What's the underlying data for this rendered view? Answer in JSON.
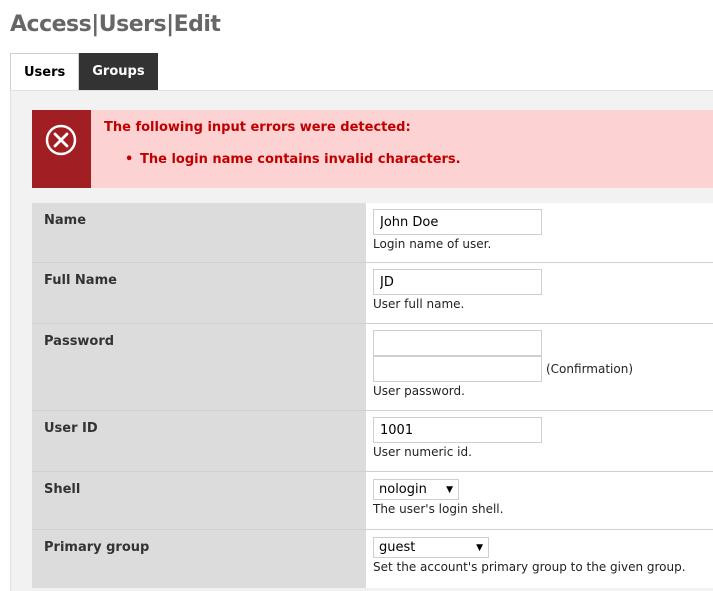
{
  "header": {
    "title": "Access|Users|Edit"
  },
  "tabs": [
    {
      "label": "Users",
      "active": true
    },
    {
      "label": "Groups",
      "active": false
    }
  ],
  "error": {
    "title": "The following input errors were detected:",
    "items": [
      "The login name contains invalid characters."
    ],
    "icon": "error-circle-x-icon",
    "colors": {
      "icon_bg": "#a11f23",
      "box_bg": "#fcd2d2",
      "text": "#c00000"
    }
  },
  "form": {
    "name": {
      "label": "Name",
      "value": "John Doe",
      "hint": "Login name of user."
    },
    "full_name": {
      "label": "Full Name",
      "value": "JD",
      "hint": "User full name."
    },
    "password": {
      "label": "Password",
      "value": "",
      "confirm_value": "",
      "confirm_label": "(Confirmation)",
      "hint": "User password."
    },
    "user_id": {
      "label": "User ID",
      "value": "1001",
      "hint": "User numeric id."
    },
    "shell": {
      "label": "Shell",
      "selected": "nologin",
      "hint": "The user's login shell."
    },
    "primary_group": {
      "label": "Primary group",
      "selected": "guest",
      "hint": "Set the account's primary group to the given group."
    }
  }
}
